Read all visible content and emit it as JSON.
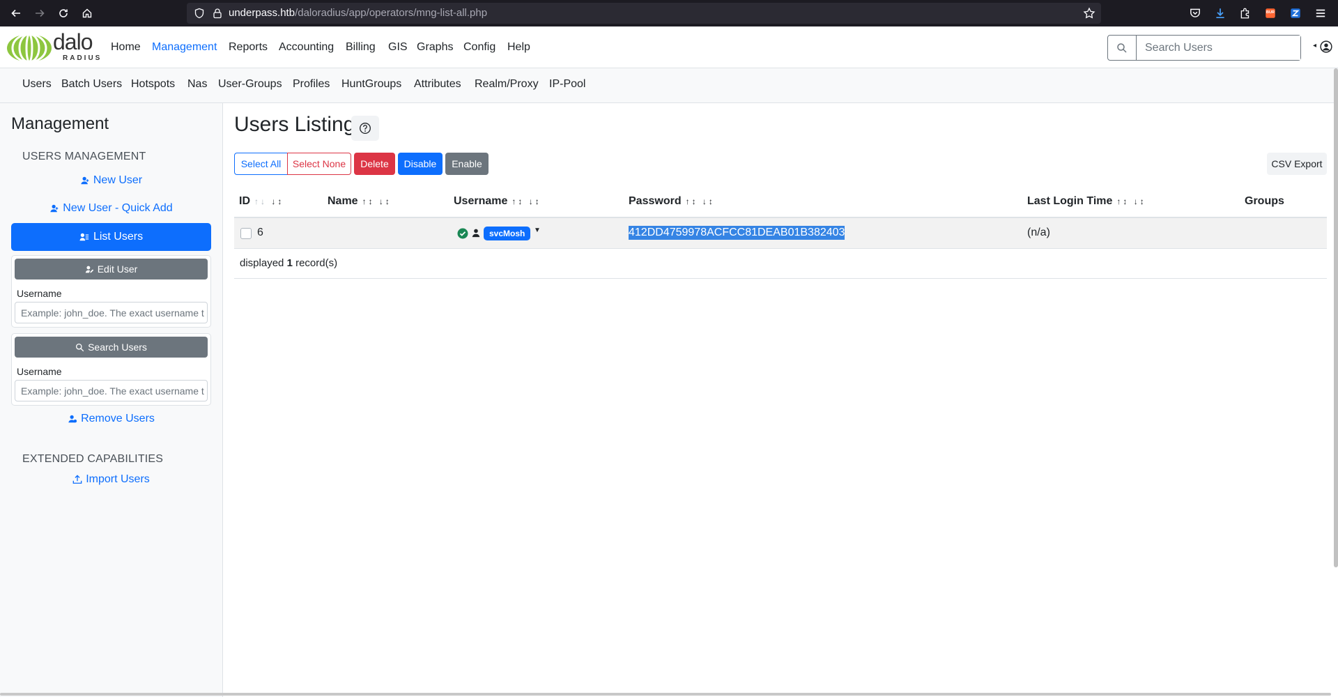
{
  "browser": {
    "url_host": "underpass.htb",
    "url_path": "/daloradius/app/operators/mng-list-all.php"
  },
  "logo": {
    "main": "dalo",
    "sub": "RADIUS"
  },
  "top_nav": [
    {
      "label": "Home"
    },
    {
      "label": "Management",
      "active": true
    },
    {
      "label": "Reports"
    },
    {
      "label": "Accounting"
    },
    {
      "label": "Billing"
    },
    {
      "label": "GIS"
    },
    {
      "label": "Graphs"
    },
    {
      "label": "Config"
    },
    {
      "label": "Help"
    }
  ],
  "search": {
    "placeholder": "Search Users"
  },
  "sub_nav": [
    "Users",
    "Batch Users",
    "Hotspots",
    "Nas",
    "User-Groups",
    "Profiles",
    "HuntGroups",
    "Attributes",
    "Realm/Proxy",
    "IP-Pool"
  ],
  "sidebar": {
    "title": "Management",
    "users_heading": "USERS MANAGEMENT",
    "new_user": "New User",
    "new_user_quick": "New User - Quick Add",
    "list_users": "List Users",
    "edit_user": {
      "button": "Edit User",
      "label": "Username",
      "placeholder": "Example: john_doe. The exact username t"
    },
    "search_users": {
      "button": "Search Users",
      "label": "Username",
      "placeholder": "Example: john_doe. The exact username t"
    },
    "remove_users": "Remove Users",
    "extended_heading": "EXTENDED CAPABILITIES",
    "import_users": "Import Users"
  },
  "main": {
    "title": "Users Listing",
    "buttons": {
      "select_all": "Select All",
      "select_none": "Select None",
      "delete": "Delete",
      "disable": "Disable",
      "enable": "Enable",
      "csv_export": "CSV Export"
    },
    "columns": {
      "id": "ID",
      "name": "Name",
      "username": "Username",
      "password": "Password",
      "last_login": "Last Login Time",
      "groups": "Groups"
    },
    "rows": [
      {
        "id": "6",
        "name": "",
        "username": "svcMosh",
        "password": "412DD4759978ACFCC81DEAB01B382403",
        "last_login": "(n/a)",
        "groups": ""
      }
    ],
    "records": {
      "prefix": "displayed",
      "count": "1",
      "suffix": "record(s)"
    }
  },
  "colors": {
    "primary": "#0d6efd",
    "danger": "#dc3545",
    "secondary": "#6c757d",
    "success": "#198754",
    "logo_green": "#8dc63f"
  }
}
